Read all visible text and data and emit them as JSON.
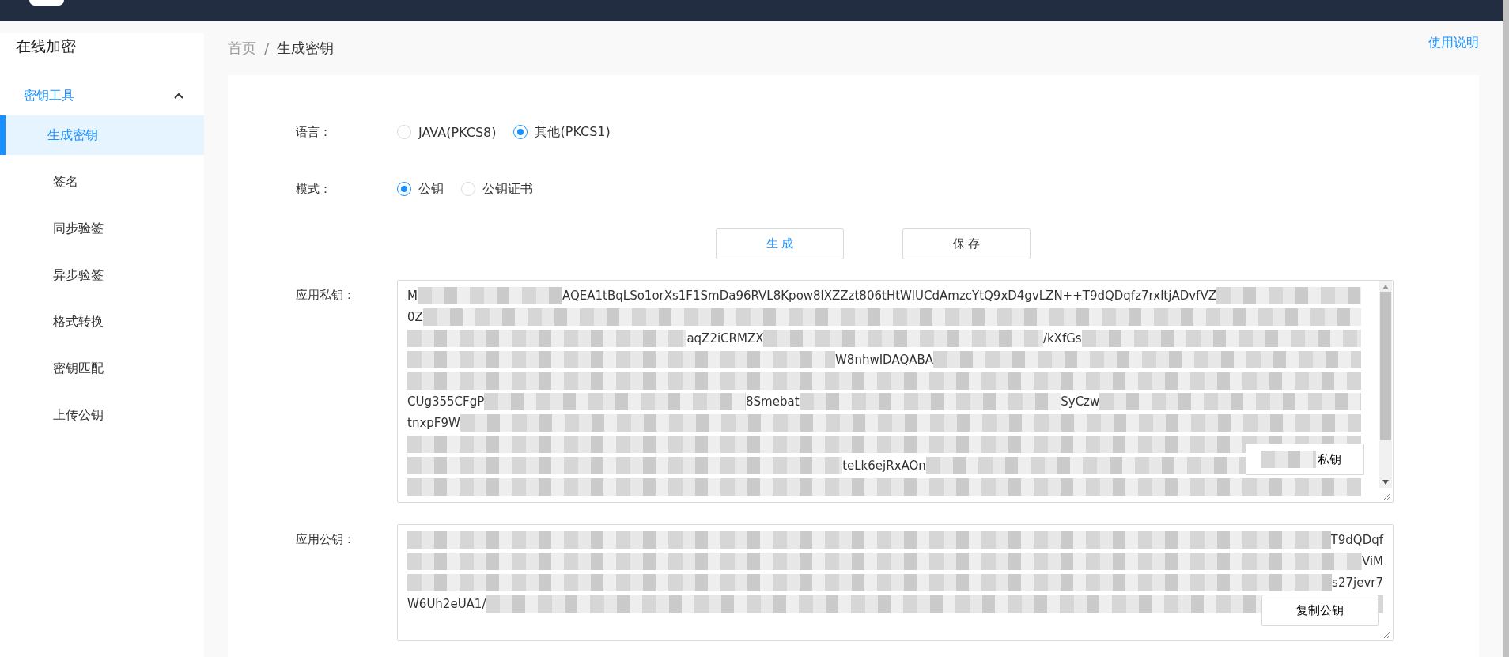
{
  "sidebar": {
    "title": "在线加密",
    "group": {
      "label": "密钥工具",
      "expanded": true,
      "items": [
        {
          "label": "生成密钥",
          "selected": true
        },
        {
          "label": "签名",
          "selected": false
        },
        {
          "label": "同步验签",
          "selected": false
        },
        {
          "label": "异步验签",
          "selected": false
        },
        {
          "label": "格式转换",
          "selected": false
        },
        {
          "label": "密钥匹配",
          "selected": false
        },
        {
          "label": "上传公钥",
          "selected": false
        }
      ]
    }
  },
  "breadcrumb_separator": "/",
  "breadcrumb": [
    {
      "label": "首页",
      "current": false
    },
    {
      "label": "生成密钥",
      "current": true
    }
  ],
  "help_link": "使用说明",
  "form": {
    "rows": [
      {
        "label": "语言：",
        "options": [
          {
            "label": "JAVA(PKCS8)",
            "selected": false
          },
          {
            "label": "其他(PKCS1)",
            "selected": true
          }
        ]
      },
      {
        "label": "模式：",
        "options": [
          {
            "label": "公钥",
            "selected": true
          },
          {
            "label": "公钥证书",
            "selected": false
          }
        ]
      }
    ],
    "buttons": [
      {
        "label": "生 成",
        "kind": "primary"
      },
      {
        "label": "保 存",
        "kind": "default"
      }
    ],
    "keys": [
      {
        "label": "应用私钥：",
        "copy_button": "私钥",
        "copy_redacted": true,
        "lines": [
          [
            {
              "kind": "text",
              "text": "M"
            },
            {
              "kind": "redacted"
            },
            {
              "kind": "text",
              "text": "AQEA1tBqLSo1orXs1F1SmDa96RVL8Kpow8lXZZzt806tHtWlUCdAmzcYtQ9xD4gvLZN++T9dQDqfz7rxltjADvfVZ"
            },
            {
              "kind": "redacted"
            }
          ],
          [
            {
              "kind": "text",
              "text": "0Z"
            },
            {
              "kind": "redacted"
            }
          ],
          [
            {
              "kind": "redacted"
            },
            {
              "kind": "text",
              "text": "aqZ2iCRMZX"
            },
            {
              "kind": "redacted"
            },
            {
              "kind": "text",
              "text": "/kXfGs"
            },
            {
              "kind": "redacted"
            }
          ],
          [
            {
              "kind": "redacted"
            },
            {
              "kind": "text",
              "text": "W8nhwIDAQABA"
            },
            {
              "kind": "redacted"
            }
          ],
          [
            {
              "kind": "redacted"
            }
          ],
          [
            {
              "kind": "text",
              "text": "CUg355CFgP"
            },
            {
              "kind": "redacted"
            },
            {
              "kind": "text",
              "text": "8Smebat"
            },
            {
              "kind": "redacted"
            },
            {
              "kind": "text",
              "text": "SyCzw"
            },
            {
              "kind": "redacted"
            }
          ],
          [
            {
              "kind": "text",
              "text": "tnxpF9W"
            },
            {
              "kind": "redacted"
            }
          ],
          [
            {
              "kind": "redacted"
            }
          ],
          [
            {
              "kind": "redacted"
            },
            {
              "kind": "text",
              "text": "teLk6ejRxAOn"
            },
            {
              "kind": "redacted"
            }
          ],
          [
            {
              "kind": "redacted"
            }
          ]
        ]
      },
      {
        "label": "应用公钥：",
        "copy_button": "复制公钥",
        "copy_redacted": false,
        "lines": [
          [
            {
              "kind": "redacted"
            },
            {
              "kind": "text",
              "text": "T9dQDqf"
            }
          ],
          [
            {
              "kind": "redacted"
            },
            {
              "kind": "text",
              "text": "ViM"
            }
          ],
          [
            {
              "kind": "redacted"
            },
            {
              "kind": "text",
              "text": "s27jevr7"
            }
          ],
          [
            {
              "kind": "text",
              "text": "W6Uh2eUA1/"
            },
            {
              "kind": "redacted"
            }
          ]
        ]
      }
    ]
  }
}
